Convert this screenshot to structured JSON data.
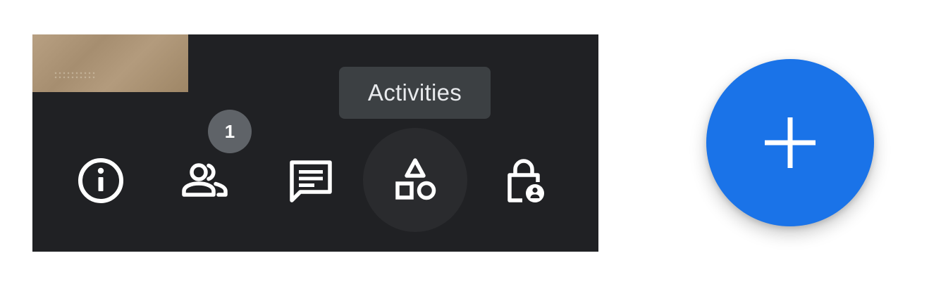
{
  "toolbar": {
    "tooltip": "Activities",
    "people_badge_count": "1",
    "buttons": [
      {
        "name": "info",
        "icon": "info-icon"
      },
      {
        "name": "people",
        "icon": "people-icon"
      },
      {
        "name": "chat",
        "icon": "chat-icon"
      },
      {
        "name": "activities",
        "icon": "activities-icon",
        "active": true
      },
      {
        "name": "host-controls",
        "icon": "lock-person-icon"
      }
    ]
  },
  "fab": {
    "icon": "plus-icon",
    "color": "#1a73e8"
  },
  "colors": {
    "bar_background": "#202124",
    "tooltip_background": "#3c4043",
    "badge_background": "#5f6368",
    "icon_color": "#ffffff"
  }
}
